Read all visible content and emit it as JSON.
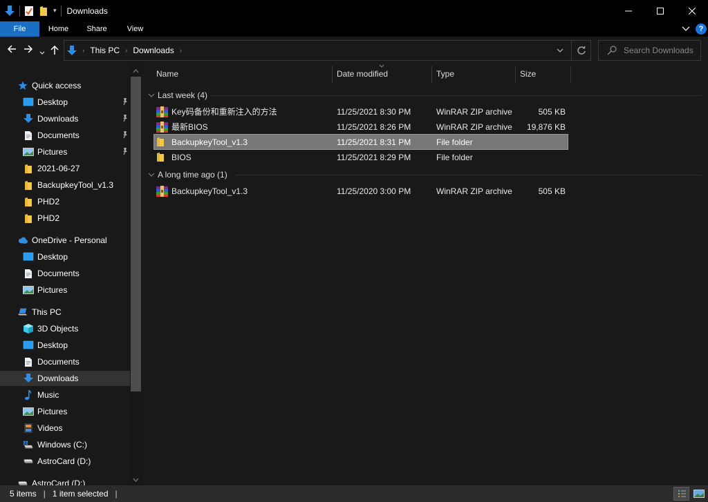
{
  "window": {
    "title": "Downloads",
    "minimize_label": "Minimize",
    "maximize_label": "Maximize",
    "close_label": "Close"
  },
  "ribbon": {
    "tabs": [
      {
        "label": "File",
        "active": true
      },
      {
        "label": "Home"
      },
      {
        "label": "Share"
      },
      {
        "label": "View"
      }
    ],
    "help_label": "?"
  },
  "address": {
    "crumbs": [
      "This PC",
      "Downloads"
    ],
    "search_placeholder": "Search Downloads"
  },
  "sidebar": {
    "sections": [
      {
        "label": "Quick access",
        "icon": "star-icon",
        "items": [
          {
            "label": "Desktop",
            "icon": "desktop-icon",
            "pinned": true
          },
          {
            "label": "Downloads",
            "icon": "download-icon",
            "pinned": true
          },
          {
            "label": "Documents",
            "icon": "documents-icon",
            "pinned": true
          },
          {
            "label": "Pictures",
            "icon": "pictures-icon",
            "pinned": true
          },
          {
            "label": "2021-06-27",
            "icon": "folder-icon"
          },
          {
            "label": "BackupkeyTool_v1.3",
            "icon": "folder-icon"
          },
          {
            "label": "PHD2",
            "icon": "folder-icon"
          },
          {
            "label": "PHD2",
            "icon": "folder-icon"
          }
        ]
      },
      {
        "label": "OneDrive - Personal",
        "icon": "onedrive-cloud-icon",
        "items": [
          {
            "label": "Desktop",
            "icon": "desktop-icon"
          },
          {
            "label": "Documents",
            "icon": "documents-icon"
          },
          {
            "label": "Pictures",
            "icon": "pictures-icon"
          }
        ]
      },
      {
        "label": "This PC",
        "icon": "this-pc-icon",
        "items": [
          {
            "label": "3D Objects",
            "icon": "3d-objects-icon"
          },
          {
            "label": "Desktop",
            "icon": "desktop-icon"
          },
          {
            "label": "Documents",
            "icon": "documents-icon"
          },
          {
            "label": "Downloads",
            "icon": "download-icon",
            "selected": true
          },
          {
            "label": "Music",
            "icon": "music-icon"
          },
          {
            "label": "Pictures",
            "icon": "pictures-icon"
          },
          {
            "label": "Videos",
            "icon": "videos-icon"
          },
          {
            "label": "Windows (C:)",
            "icon": "windows-drive-icon"
          },
          {
            "label": "AstroCard (D:)",
            "icon": "drive-icon"
          }
        ]
      },
      {
        "label": "AstroCard (D:)",
        "icon": "drive-icon",
        "items": []
      }
    ]
  },
  "columns": {
    "name": "Name",
    "date": "Date modified",
    "type": "Type",
    "size": "Size"
  },
  "groups": [
    {
      "label": "Last week (4)",
      "files": [
        {
          "name": "Key码备份和重新注入的方法",
          "date": "11/25/2021 8:30 PM",
          "type": "WinRAR ZIP archive",
          "size": "505 KB",
          "icon": "winrar-archive-icon"
        },
        {
          "name": "最新BIOS",
          "date": "11/25/2021 8:26 PM",
          "type": "WinRAR ZIP archive",
          "size": "19,876 KB",
          "icon": "winrar-archive-icon"
        },
        {
          "name": "BackupkeyTool_v1.3",
          "date": "11/25/2021 8:31 PM",
          "type": "File folder",
          "size": "",
          "icon": "folder-icon",
          "selected": true
        },
        {
          "name": "BIOS",
          "date": "11/25/2021 8:29 PM",
          "type": "File folder",
          "size": "",
          "icon": "folder-icon"
        }
      ]
    },
    {
      "label": "A long time ago (1)",
      "files": [
        {
          "name": "BackupkeyTool_v1.3",
          "date": "11/25/2020 3:00 PM",
          "type": "WinRAR ZIP archive",
          "size": "505 KB",
          "icon": "winrar-archive-icon"
        }
      ]
    }
  ],
  "status": {
    "item_count": "5 items",
    "selection": "1 item selected"
  },
  "colors": {
    "accent": "#1a6fc4",
    "folder": "#f3c94a",
    "selection": "#777777",
    "background": "#191919"
  }
}
